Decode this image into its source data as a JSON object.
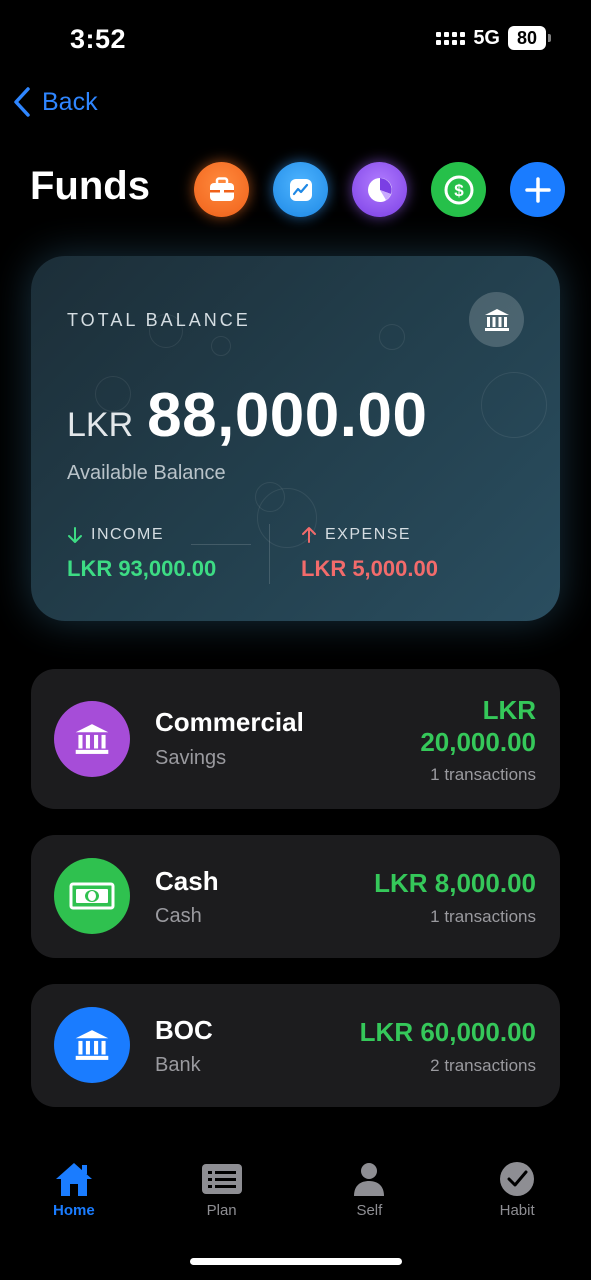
{
  "status_bar": {
    "time": "3:52",
    "network": "5G",
    "battery": "80"
  },
  "nav": {
    "back_label": "Back"
  },
  "header": {
    "title": "Funds",
    "actions": [
      {
        "icon": "briefcase-icon",
        "color": "#f26a24"
      },
      {
        "icon": "trend-chart-icon",
        "color": "#2a93f0"
      },
      {
        "icon": "pie-chart-icon",
        "color": "#8a4ff0"
      },
      {
        "icon": "dollar-icon",
        "color": "#26c04a"
      },
      {
        "icon": "plus-icon",
        "color": "#1a7cff"
      }
    ]
  },
  "balance_card": {
    "label": "TOTAL BALANCE",
    "currency": "LKR",
    "amount": "88,000.00",
    "subtitle": "Available Balance",
    "income_label": "INCOME",
    "income_value": "LKR 93,000.00",
    "expense_label": "EXPENSE",
    "expense_value": "LKR 5,000.00"
  },
  "accounts": [
    {
      "name": "Commercial",
      "type": "Savings",
      "amount_currency": "LKR",
      "amount_value": "20,000.00",
      "transactions": "1 transactions",
      "color": "#a64dd8",
      "icon": "bank-icon"
    },
    {
      "name": "Cash",
      "type": "Cash",
      "amount": "LKR 8,000.00",
      "transactions": "1 transactions",
      "color": "#2fc14f",
      "icon": "banknote-icon"
    },
    {
      "name": "BOC",
      "type": "Bank",
      "amount": "LKR 60,000.00",
      "transactions": "2 transactions",
      "color": "#1a7cff",
      "icon": "bank-icon"
    }
  ],
  "tabs": [
    {
      "label": "Home",
      "icon": "home-icon",
      "active": true
    },
    {
      "label": "Plan",
      "icon": "list-icon",
      "active": false
    },
    {
      "label": "Self",
      "icon": "person-icon",
      "active": false
    },
    {
      "label": "Habit",
      "icon": "checkmark-icon",
      "active": false
    }
  ]
}
